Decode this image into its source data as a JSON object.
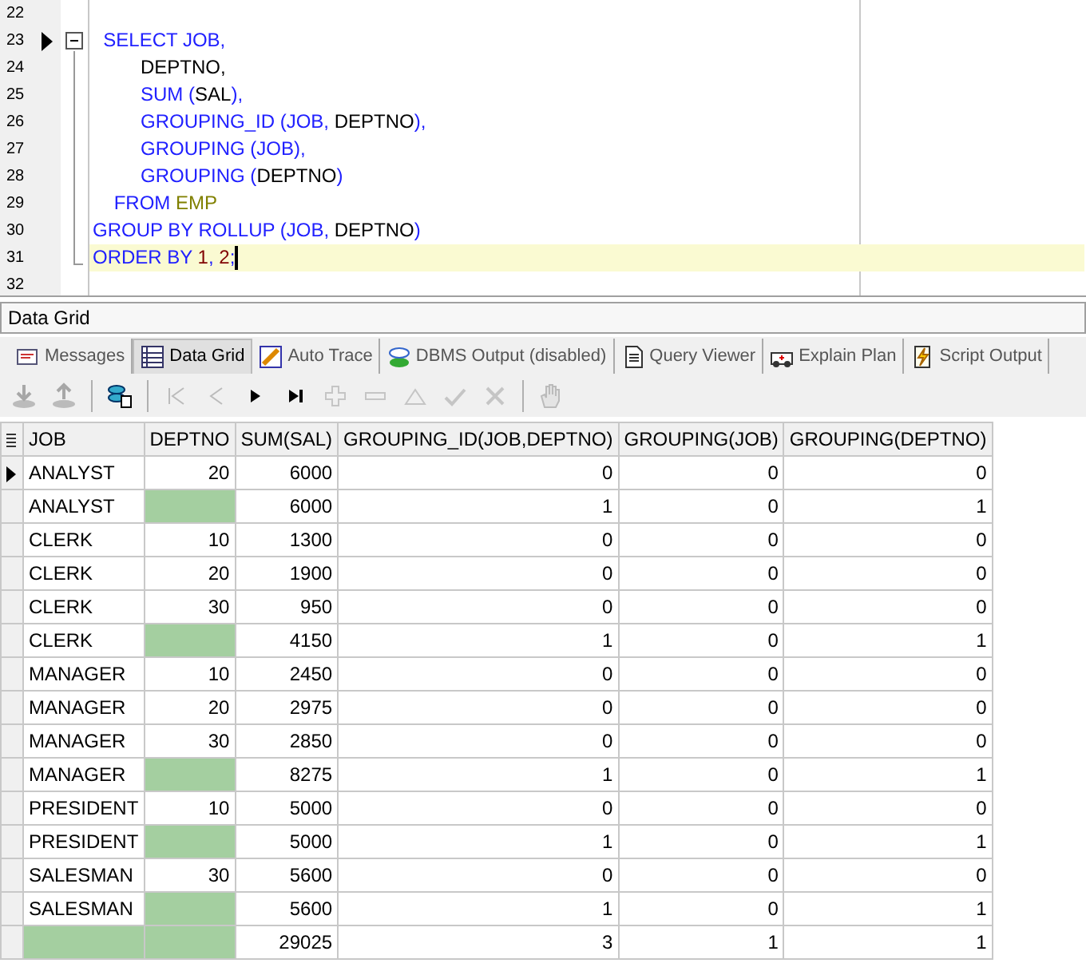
{
  "editor": {
    "lines": [
      {
        "number": "22",
        "marker": false,
        "collapsible": false,
        "current": false
      },
      {
        "number": "23",
        "marker": true,
        "collapsible": true,
        "current": false,
        "tokens": [
          {
            "kind": "keyword",
            "text": "  SELECT JOB,"
          }
        ]
      },
      {
        "number": "24",
        "marker": false,
        "collapsible": false,
        "current": false,
        "tokens": [
          {
            "kind": "ident",
            "text": "         DEPTNO,"
          }
        ]
      },
      {
        "number": "25",
        "marker": false,
        "collapsible": false,
        "current": false,
        "tokens": [
          {
            "kind": "keyword",
            "text": "         SUM ("
          },
          {
            "kind": "ident",
            "text": "SAL"
          },
          {
            "kind": "keyword",
            "text": "),"
          }
        ]
      },
      {
        "number": "26",
        "marker": false,
        "collapsible": false,
        "current": false,
        "tokens": [
          {
            "kind": "keyword",
            "text": "         GROUPING_ID (JOB, "
          },
          {
            "kind": "ident",
            "text": "DEPTNO"
          },
          {
            "kind": "keyword",
            "text": "),"
          }
        ]
      },
      {
        "number": "27",
        "marker": false,
        "collapsible": false,
        "current": false,
        "tokens": [
          {
            "kind": "keyword",
            "text": "         GROUPING (JOB),"
          }
        ]
      },
      {
        "number": "28",
        "marker": false,
        "collapsible": false,
        "current": false,
        "tokens": [
          {
            "kind": "keyword",
            "text": "         GROUPING ("
          },
          {
            "kind": "ident",
            "text": "DEPTNO"
          },
          {
            "kind": "keyword",
            "text": ")"
          }
        ]
      },
      {
        "number": "29",
        "marker": false,
        "collapsible": false,
        "current": false,
        "tokens": [
          {
            "kind": "keyword",
            "text": "    FROM "
          },
          {
            "kind": "table",
            "text": "EMP"
          }
        ]
      },
      {
        "number": "30",
        "marker": false,
        "collapsible": false,
        "current": false,
        "tokens": [
          {
            "kind": "keyword",
            "text": "GROUP BY ROLLUP (JOB, "
          },
          {
            "kind": "ident",
            "text": "DEPTNO"
          },
          {
            "kind": "keyword",
            "text": ")"
          }
        ]
      },
      {
        "number": "31",
        "marker": false,
        "collapsible": false,
        "current": true,
        "tokens": [
          {
            "kind": "keyword",
            "text": "ORDER BY "
          },
          {
            "kind": "number",
            "text": "1"
          },
          {
            "kind": "keyword",
            "text": ", "
          },
          {
            "kind": "number",
            "text": "2"
          },
          {
            "kind": "keyword",
            "text": ";"
          }
        ]
      },
      {
        "number": "32",
        "marker": false,
        "collapsible": false,
        "current": false
      }
    ]
  },
  "panel_title": "Data Grid",
  "tabs": [
    {
      "label": "Messages",
      "kind": "messages",
      "selected": false
    },
    {
      "label": "Data Grid",
      "kind": "grid",
      "selected": true
    },
    {
      "label": "Auto Trace",
      "kind": "trace",
      "selected": false
    },
    {
      "label": "DBMS Output (disabled)",
      "kind": "dbms",
      "selected": false
    },
    {
      "label": "Query Viewer",
      "kind": "query",
      "selected": false
    },
    {
      "label": "Explain Plan",
      "kind": "plan",
      "selected": false
    },
    {
      "label": "Script Output",
      "kind": "script",
      "selected": false
    }
  ],
  "toolbar": [
    {
      "kind": "download",
      "disabled": true
    },
    {
      "kind": "upload",
      "disabled": true
    },
    {
      "kind": "sep"
    },
    {
      "kind": "export",
      "disabled": false
    },
    {
      "kind": "sep"
    },
    {
      "kind": "first",
      "disabled": true
    },
    {
      "kind": "prior",
      "disabled": true
    },
    {
      "kind": "next",
      "disabled": false
    },
    {
      "kind": "last",
      "disabled": false
    },
    {
      "kind": "insert",
      "disabled": true
    },
    {
      "kind": "delete",
      "disabled": true
    },
    {
      "kind": "edit",
      "disabled": true
    },
    {
      "kind": "post",
      "disabled": true
    },
    {
      "kind": "cancel",
      "disabled": true
    },
    {
      "kind": "sep"
    },
    {
      "kind": "hand",
      "disabled": true
    }
  ],
  "grid": {
    "columns": [
      "JOB",
      "DEPTNO",
      "SUM(SAL)",
      "GROUPING_ID(JOB,DEPTNO)",
      "GROUPING(JOB)",
      "GROUPING(DEPTNO)"
    ],
    "rows": [
      {
        "selected": true,
        "cells": [
          "ANALYST",
          "20",
          "6000",
          "0",
          "0",
          "0"
        ]
      },
      {
        "selected": false,
        "cells": [
          "ANALYST",
          null,
          "6000",
          "1",
          "0",
          "1"
        ]
      },
      {
        "selected": false,
        "cells": [
          "CLERK",
          "10",
          "1300",
          "0",
          "0",
          "0"
        ]
      },
      {
        "selected": false,
        "cells": [
          "CLERK",
          "20",
          "1900",
          "0",
          "0",
          "0"
        ]
      },
      {
        "selected": false,
        "cells": [
          "CLERK",
          "30",
          "950",
          "0",
          "0",
          "0"
        ]
      },
      {
        "selected": false,
        "cells": [
          "CLERK",
          null,
          "4150",
          "1",
          "0",
          "1"
        ]
      },
      {
        "selected": false,
        "cells": [
          "MANAGER",
          "10",
          "2450",
          "0",
          "0",
          "0"
        ]
      },
      {
        "selected": false,
        "cells": [
          "MANAGER",
          "20",
          "2975",
          "0",
          "0",
          "0"
        ]
      },
      {
        "selected": false,
        "cells": [
          "MANAGER",
          "30",
          "2850",
          "0",
          "0",
          "0"
        ]
      },
      {
        "selected": false,
        "cells": [
          "MANAGER",
          null,
          "8275",
          "1",
          "0",
          "1"
        ]
      },
      {
        "selected": false,
        "cells": [
          "PRESIDENT",
          "10",
          "5000",
          "0",
          "0",
          "0"
        ]
      },
      {
        "selected": false,
        "cells": [
          "PRESIDENT",
          null,
          "5000",
          "1",
          "0",
          "1"
        ]
      },
      {
        "selected": false,
        "cells": [
          "SALESMAN",
          "30",
          "5600",
          "0",
          "0",
          "0"
        ]
      },
      {
        "selected": false,
        "cells": [
          "SALESMAN",
          null,
          "5600",
          "1",
          "0",
          "1"
        ]
      },
      {
        "selected": false,
        "cells": [
          null,
          null,
          "29025",
          "3",
          "1",
          "1"
        ]
      }
    ]
  }
}
